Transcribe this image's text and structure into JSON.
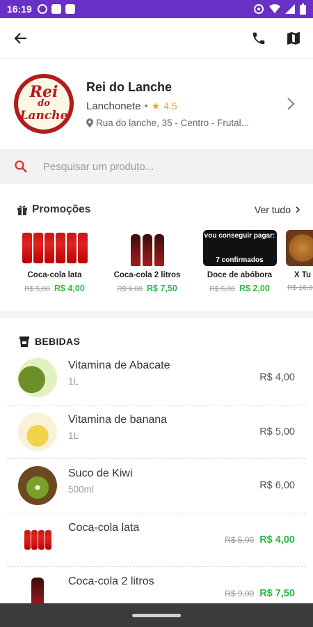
{
  "status_bar": {
    "time": "16:19"
  },
  "store": {
    "name": "Rei do Lanche",
    "category": "Lanchonete",
    "rating": "4.5",
    "address": "Rua do lanche, 35 - Centro - Frutal...",
    "logo_line1": "Rei",
    "logo_line2": "do",
    "logo_line3": "Lanche"
  },
  "search": {
    "placeholder": "Pesquisar um produto..."
  },
  "promotions": {
    "title": "Promoções",
    "see_all": "Ver tudo",
    "items": [
      {
        "name": "Coca-cola lata",
        "old_price": "R$ 5,00",
        "price": "R$ 4,00"
      },
      {
        "name": "Coca-cola 2 litros",
        "old_price": "R$ 9,00",
        "price": "R$ 7,50"
      },
      {
        "name": "Doce de abóbora",
        "old_price": "R$ 5,00",
        "price": "R$ 2,00",
        "thumb_text_top": "vou conseguir pagar:",
        "thumb_text_bottom": "7 confirmados"
      },
      {
        "name": "X Tu",
        "old_price": "R$ 16,0"
      }
    ]
  },
  "section": {
    "title": "BEBIDAS",
    "items": [
      {
        "name": "Vitamina de Abacate",
        "desc": "1L",
        "price": "R$ 4,00"
      },
      {
        "name": "Vitamina de banana",
        "desc": "1L",
        "price": "R$ 5,00"
      },
      {
        "name": "Suco de Kiwi",
        "desc": "500ml",
        "price": "R$ 6,00"
      },
      {
        "name": "Coca-cola lata",
        "old_price": "R$ 5,00",
        "price": "R$ 4,00"
      },
      {
        "name": "Coca-cola 2 litros",
        "old_price": "R$ 9,00",
        "price": "R$ 7,50"
      }
    ]
  },
  "colors": {
    "accent": "#6a2fc4",
    "promo_price": "#2eb845",
    "rating_star": "#f5a623",
    "search_icon": "#e0282d"
  }
}
